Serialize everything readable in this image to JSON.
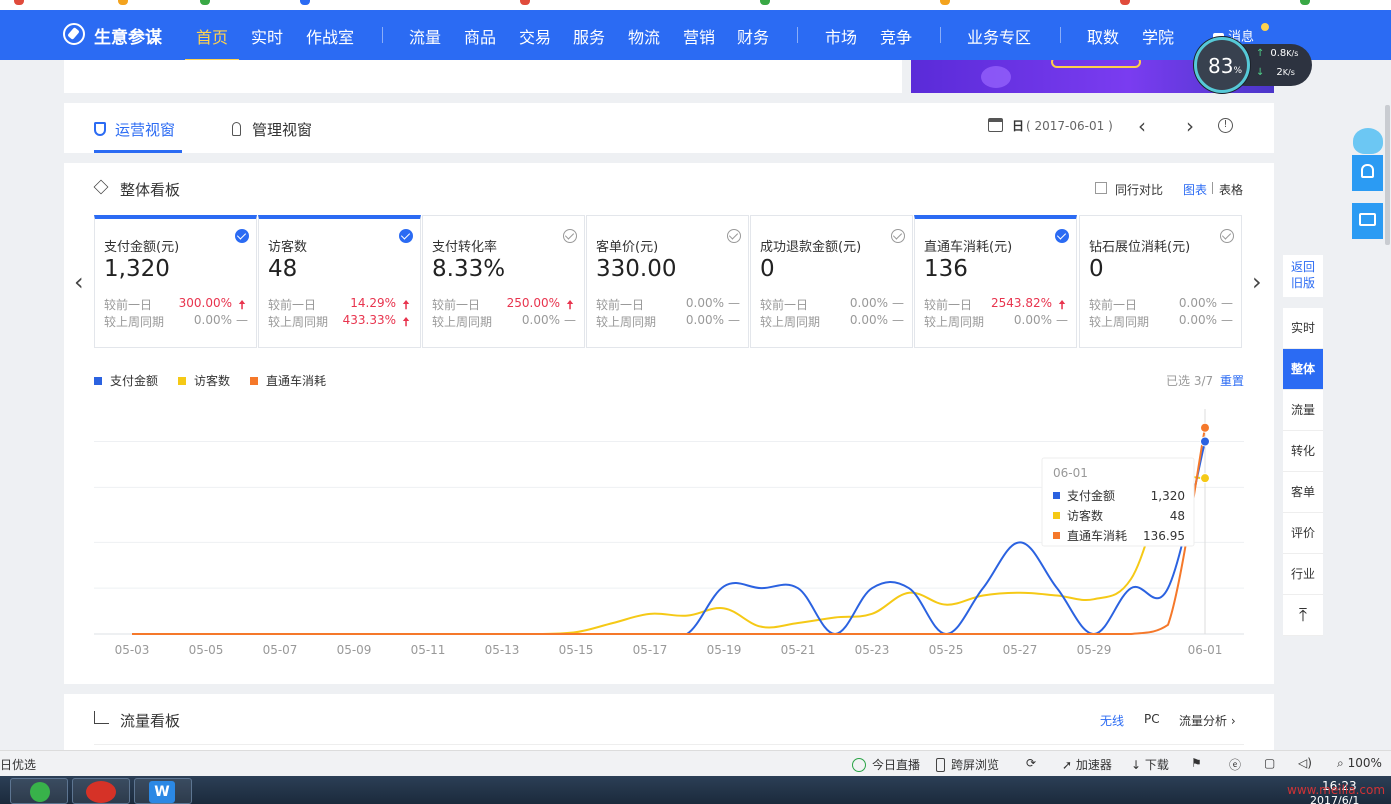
{
  "nav": {
    "brand": "生意参谋",
    "items": [
      "首页",
      "实时",
      "作战室",
      "流量",
      "商品",
      "交易",
      "服务",
      "物流",
      "营销",
      "财务",
      "市场",
      "竞争",
      "业务专区",
      "取数",
      "学院"
    ],
    "message": "消息"
  },
  "speed_widget": {
    "percent": "83",
    "percent_unit": "%",
    "upload": "0.8",
    "upload_unit": "K/s",
    "download": "2",
    "download_unit": "K/s"
  },
  "view_tabs": {
    "operations": "运营视窗",
    "management": "管理视窗"
  },
  "date_control": {
    "period": "日",
    "date": "( 2017-06-01 )"
  },
  "dashboard": {
    "title": "整体看板",
    "industry_compare": "同行对比",
    "view_chart": "图表",
    "view_table": "表格",
    "selected_count": "已选 3/7",
    "reset": "重置",
    "cards": [
      {
        "title": "支付金额(元)",
        "value": "1,320",
        "selected": true,
        "prev_day_label": "较前一日",
        "prev_day": "300.00%",
        "prev_day_dir": "up",
        "prev_week_label": "较上周同期",
        "prev_week": "0.00%",
        "prev_week_dir": "flat"
      },
      {
        "title": "访客数",
        "value": "48",
        "selected": true,
        "prev_day_label": "较前一日",
        "prev_day": "14.29%",
        "prev_day_dir": "up",
        "prev_week_label": "较上周同期",
        "prev_week": "433.33%",
        "prev_week_dir": "up"
      },
      {
        "title": "支付转化率",
        "value": "8.33%",
        "selected": false,
        "prev_day_label": "较前一日",
        "prev_day": "250.00%",
        "prev_day_dir": "up",
        "prev_week_label": "较上周同期",
        "prev_week": "0.00%",
        "prev_week_dir": "flat"
      },
      {
        "title": "客单价(元)",
        "value": "330.00",
        "selected": false,
        "prev_day_label": "较前一日",
        "prev_day": "0.00%",
        "prev_day_dir": "flat",
        "prev_week_label": "较上周同期",
        "prev_week": "0.00%",
        "prev_week_dir": "flat"
      },
      {
        "title": "成功退款金额(元)",
        "value": "0",
        "selected": false,
        "prev_day_label": "较前一日",
        "prev_day": "0.00%",
        "prev_day_dir": "flat",
        "prev_week_label": "较上周同期",
        "prev_week": "0.00%",
        "prev_week_dir": "flat"
      },
      {
        "title": "直通车消耗(元)",
        "value": "136",
        "selected": true,
        "prev_day_label": "较前一日",
        "prev_day": "2543.82%",
        "prev_day_dir": "up",
        "prev_week_label": "较上周同期",
        "prev_week": "0.00%",
        "prev_week_dir": "flat"
      },
      {
        "title": "钻石展位消耗(元)",
        "value": "0",
        "selected": false,
        "prev_day_label": "较前一日",
        "prev_day": "0.00%",
        "prev_day_dir": "flat",
        "prev_week_label": "较上周同期",
        "prev_week": "0.00%",
        "prev_week_dir": "flat"
      }
    ],
    "arrow_glyphs": {
      "up": "🠅",
      "flat": "—"
    }
  },
  "chart_data": {
    "type": "line",
    "categories": [
      "05-03",
      "05-04",
      "05-05",
      "05-06",
      "05-07",
      "05-08",
      "05-09",
      "05-10",
      "05-11",
      "05-12",
      "05-13",
      "05-14",
      "05-15",
      "05-16",
      "05-17",
      "05-18",
      "05-19",
      "05-20",
      "05-21",
      "05-22",
      "05-23",
      "05-24",
      "05-25",
      "05-26",
      "05-27",
      "05-28",
      "05-29",
      "05-30",
      "05-31",
      "06-01"
    ],
    "x_tick_labels": [
      "05-03",
      "05-05",
      "05-07",
      "05-09",
      "05-11",
      "05-13",
      "05-15",
      "05-17",
      "05-19",
      "05-21",
      "05-23",
      "05-25",
      "05-27",
      "05-29",
      "06-01"
    ],
    "series": [
      {
        "name": "支付金额",
        "color": "#2b62e0",
        "values": [
          0,
          0,
          0,
          0,
          0,
          0,
          0,
          0,
          0,
          0,
          0,
          0,
          0,
          0,
          0,
          0,
          52,
          50,
          50,
          0,
          50,
          50,
          0,
          50,
          100,
          50,
          0,
          50,
          50,
          210
        ]
      },
      {
        "name": "访客数",
        "color": "#f5c916",
        "values": [
          0,
          0,
          0,
          0,
          0,
          0,
          0,
          0,
          0,
          0,
          0,
          0,
          2,
          12,
          22,
          20,
          28,
          8,
          12,
          18,
          22,
          45,
          32,
          42,
          45,
          42,
          38,
          60,
          160,
          170
        ]
      },
      {
        "name": "直通车消耗",
        "color": "#f5782a",
        "values": [
          0,
          0,
          0,
          0,
          0,
          0,
          0,
          0,
          0,
          0,
          0,
          0,
          0,
          0,
          0,
          0,
          0,
          0,
          0,
          0,
          0,
          0,
          0,
          0,
          0,
          0,
          0,
          0,
          10,
          225
        ]
      }
    ],
    "y_domain": [
      0,
      240
    ],
    "y_gridlines": [
      0,
      50,
      100,
      160,
      210
    ],
    "y_tick_labels_shown": false,
    "grid": true,
    "legend_placement": "top-left",
    "tooltip": {
      "date": "06-01",
      "rows": [
        {
          "name": "支付金额",
          "value": "1,320"
        },
        {
          "name": "访客数",
          "value": "48"
        },
        {
          "name": "直通车消耗",
          "value": "136.95"
        }
      ]
    }
  },
  "side_tools": {
    "back_old": [
      "返回",
      "旧版"
    ],
    "items": [
      "实时",
      "整体",
      "流量",
      "转化",
      "客单",
      "评价",
      "行业"
    ],
    "active": "整体"
  },
  "flow_panel": {
    "title": "流量看板",
    "wireless": "无线",
    "pc": "PC",
    "analysis": "流量分析"
  },
  "status_bar": {
    "left": "日优选",
    "live": "今日直播",
    "cross_screen": "跨屏浏览",
    "accelerator": "加速器",
    "download": "下载",
    "zoom": "100%"
  },
  "taskbar": {
    "time": "16:23",
    "date": "2017/6/1",
    "watermark": "www.meilia.com"
  },
  "colors": {
    "brand_blue": "#2b6bf3",
    "accent_yellow": "#ffd24d",
    "up_red": "#e8344e"
  }
}
